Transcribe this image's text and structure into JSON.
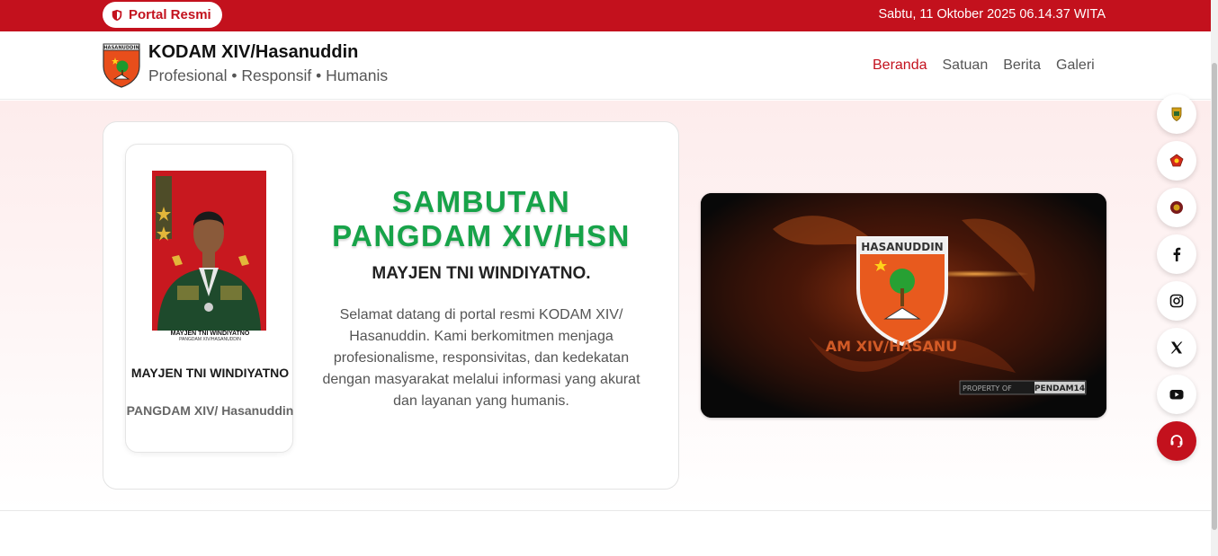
{
  "topbar": {
    "portal_label": "Portal Resmi",
    "datetime": "Sabtu, 11 Oktober 2025 06.14.37 WITA"
  },
  "header": {
    "logo_text": "HASANUDDIN",
    "title": "KODAM XIV/Hasanuddin",
    "tagline": "Profesional • Responsif • Humanis"
  },
  "nav": {
    "items": [
      {
        "label": "Beranda",
        "active": true
      },
      {
        "label": "Satuan"
      },
      {
        "label": "Berita"
      },
      {
        "label": "Galeri"
      }
    ]
  },
  "hero": {
    "photo_caption_name": "MAYJEN TNI WINDIYATNO",
    "photo_caption_rank": "PANGDAM XIV/HASANUDDIN",
    "profile_name": "MAYJEN TNI WINDIYATNO",
    "profile_rank": "PANGDAM XIV/ Hasanuddin",
    "heading": "SAMBUTAN PANGDAM XIV/HSN",
    "subheading": "MAYJEN TNI WINDIYATNO.",
    "welcome_text": "Selamat datang di portal resmi KODAM XIV/ Hasanuddin. Kami berkomitmen menjaga profesionalisme, responsivitas, dan kedekatan dengan masyarakat melalui informasi yang akurat dan layanan yang humanis."
  },
  "video": {
    "emblem_text": "HASANUDDIN",
    "overlay_text": "AM XIV/HASANU",
    "watermark_prefix": "PROPERTY OF",
    "watermark_brand": "PENDAM14"
  },
  "socials": [
    {
      "icon": "emblem-gold-icon"
    },
    {
      "icon": "emblem-red-icon"
    },
    {
      "icon": "emblem-maroon-icon"
    },
    {
      "icon": "facebook-icon"
    },
    {
      "icon": "instagram-icon"
    },
    {
      "icon": "x-icon"
    },
    {
      "icon": "youtube-icon"
    },
    {
      "icon": "headset-icon"
    }
  ],
  "colors": {
    "brand_red": "#c3111d",
    "heading_green": "#17a349"
  }
}
